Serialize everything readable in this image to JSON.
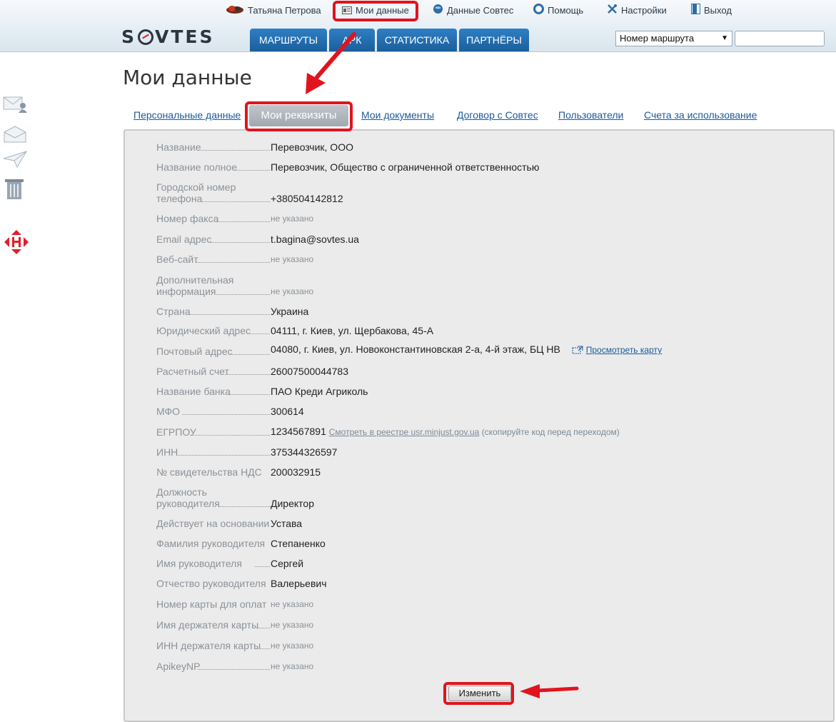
{
  "topbar": {
    "user_name": "Татьяна Петрова",
    "my_data": "Мои данные",
    "sovtes_data": "Данные Совтес",
    "help": "Помощь",
    "settings": "Настройки",
    "logout": "Выход"
  },
  "header": {
    "logo_text": [
      "S",
      "VTES"
    ],
    "nav": [
      "МАРШРУТЫ",
      "АРК",
      "СТАТИСТИКА",
      "ПАРТНЁРЫ"
    ],
    "route_select_value": "Номер маршрута",
    "route_input_value": ""
  },
  "page": {
    "title": "Мои данные",
    "tabs": {
      "personal": "Персональные данные",
      "requisites": "Мои реквизиты",
      "documents": "Мои документы",
      "contract": "Договор с Совтес",
      "users": "Пользователи",
      "invoices": "Счета за использование"
    }
  },
  "fields": {
    "name": {
      "label": "Название",
      "value": "Перевозчик, ООО"
    },
    "full_name": {
      "label": "Название полное",
      "value": "Перевозчик, Общество с ограниченной ответственностью"
    },
    "city_phone": {
      "label": "Городской номер телефона",
      "value": "+380504142812"
    },
    "fax": {
      "label": "Номер факса",
      "value": "не указано"
    },
    "email": {
      "label": "Email адрес",
      "value": "t.bagina@sovtes.ua"
    },
    "website": {
      "label": "Веб-сайт",
      "value": "не указано"
    },
    "extra_info": {
      "label": "Дополнительная информация",
      "value": "не указано"
    },
    "country": {
      "label": "Страна",
      "value": "Украина"
    },
    "legal_address": {
      "label": "Юридический адрес",
      "value": "04111, г. Киев, ул. Щербакова, 45-А"
    },
    "postal_address": {
      "label": "Почтовый адрес",
      "value": "04080, г. Киев, ул. Новоконстантиновская 2-а, 4-й этаж, БЦ НВ",
      "map_link": "Просмотреть карту"
    },
    "account": {
      "label": "Расчетный счет",
      "value": "26007500044783"
    },
    "bank": {
      "label": "Название банка",
      "value": "ПАО Креди Агриколь"
    },
    "mfo": {
      "label": "МФО",
      "value": "300614"
    },
    "egrpou": {
      "label": "ЕГРПОУ",
      "value": "1234567891",
      "registry_link": "Смотреть в реестре usr.minjust.gov.ua",
      "registry_note": "(скопируйте код перед переходом)"
    },
    "inn": {
      "label": "ИНН",
      "value": "375344326597"
    },
    "vat_cert": {
      "label": "№ свидетельства НДС",
      "value": "200032915"
    },
    "head_position": {
      "label": "Должность руководителя",
      "value": "Директор"
    },
    "acts_basis": {
      "label": "Действует на основании",
      "value": "Устава"
    },
    "head_last_name": {
      "label": "Фамилия руководителя",
      "value": "Степаненко"
    },
    "head_first_name": {
      "label": "Имя руководителя",
      "value": "Сергей"
    },
    "head_patronymic": {
      "label": "Отчество руководителя",
      "value": "Валерьевич"
    },
    "card_number": {
      "label": "Номер карты для оплат",
      "value": "не указано"
    },
    "card_holder": {
      "label": "Имя держателя карты",
      "value": "не указано"
    },
    "card_holder_inn": {
      "label": "ИНН держателя карты",
      "value": "не указано"
    },
    "apikey": {
      "label": "ApikeyNP",
      "value": "не указано"
    }
  },
  "actions": {
    "edit_label": "Изменить"
  },
  "colors": {
    "nav_blue": "#1f6aab",
    "link": "#1a5a9a",
    "panel_bg": "#ebebeb",
    "annotation_red": "#e0141e"
  }
}
